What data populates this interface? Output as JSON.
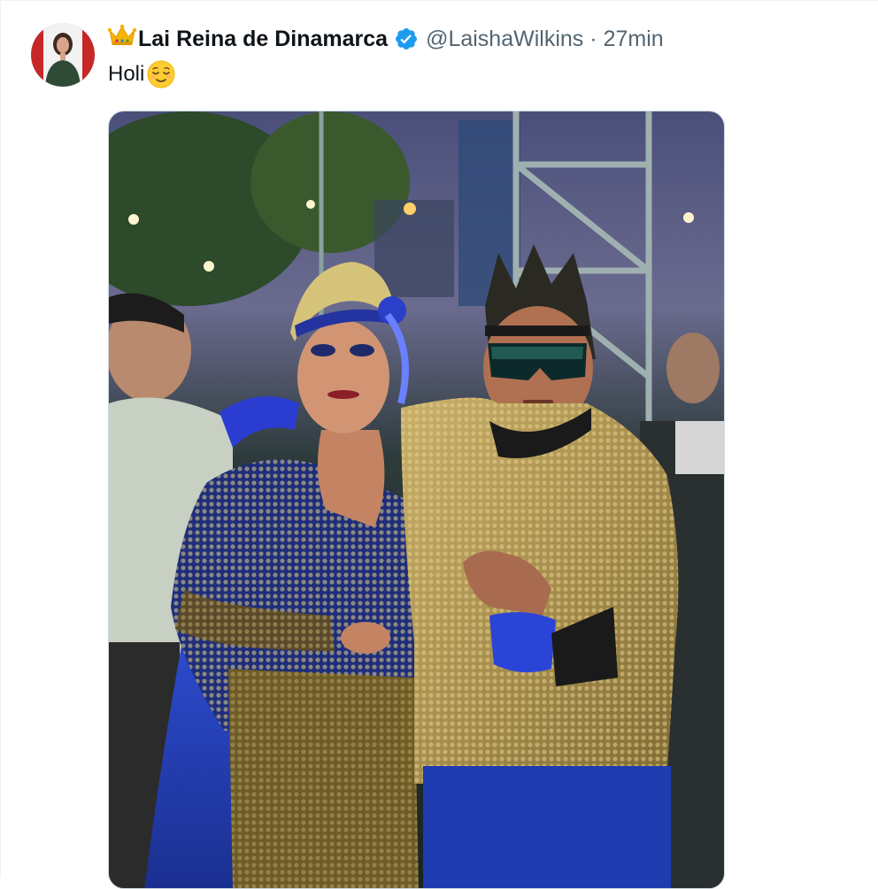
{
  "tweet": {
    "author": {
      "crown_icon": "crown-emoji",
      "display_name": "Lai Reina de Dinamarca",
      "verified_icon": "verified-badge-icon",
      "verified_color": "#1d9bf0",
      "handle": "@LaishaWilkins"
    },
    "separator": "·",
    "timestamp": "27min",
    "text": "Holi",
    "text_emoji": "relieved-face-emoji",
    "media": {
      "type": "photo"
    }
  },
  "colors": {
    "text_primary": "#0f1419",
    "text_secondary": "#536471",
    "border": "#cfd9de"
  }
}
